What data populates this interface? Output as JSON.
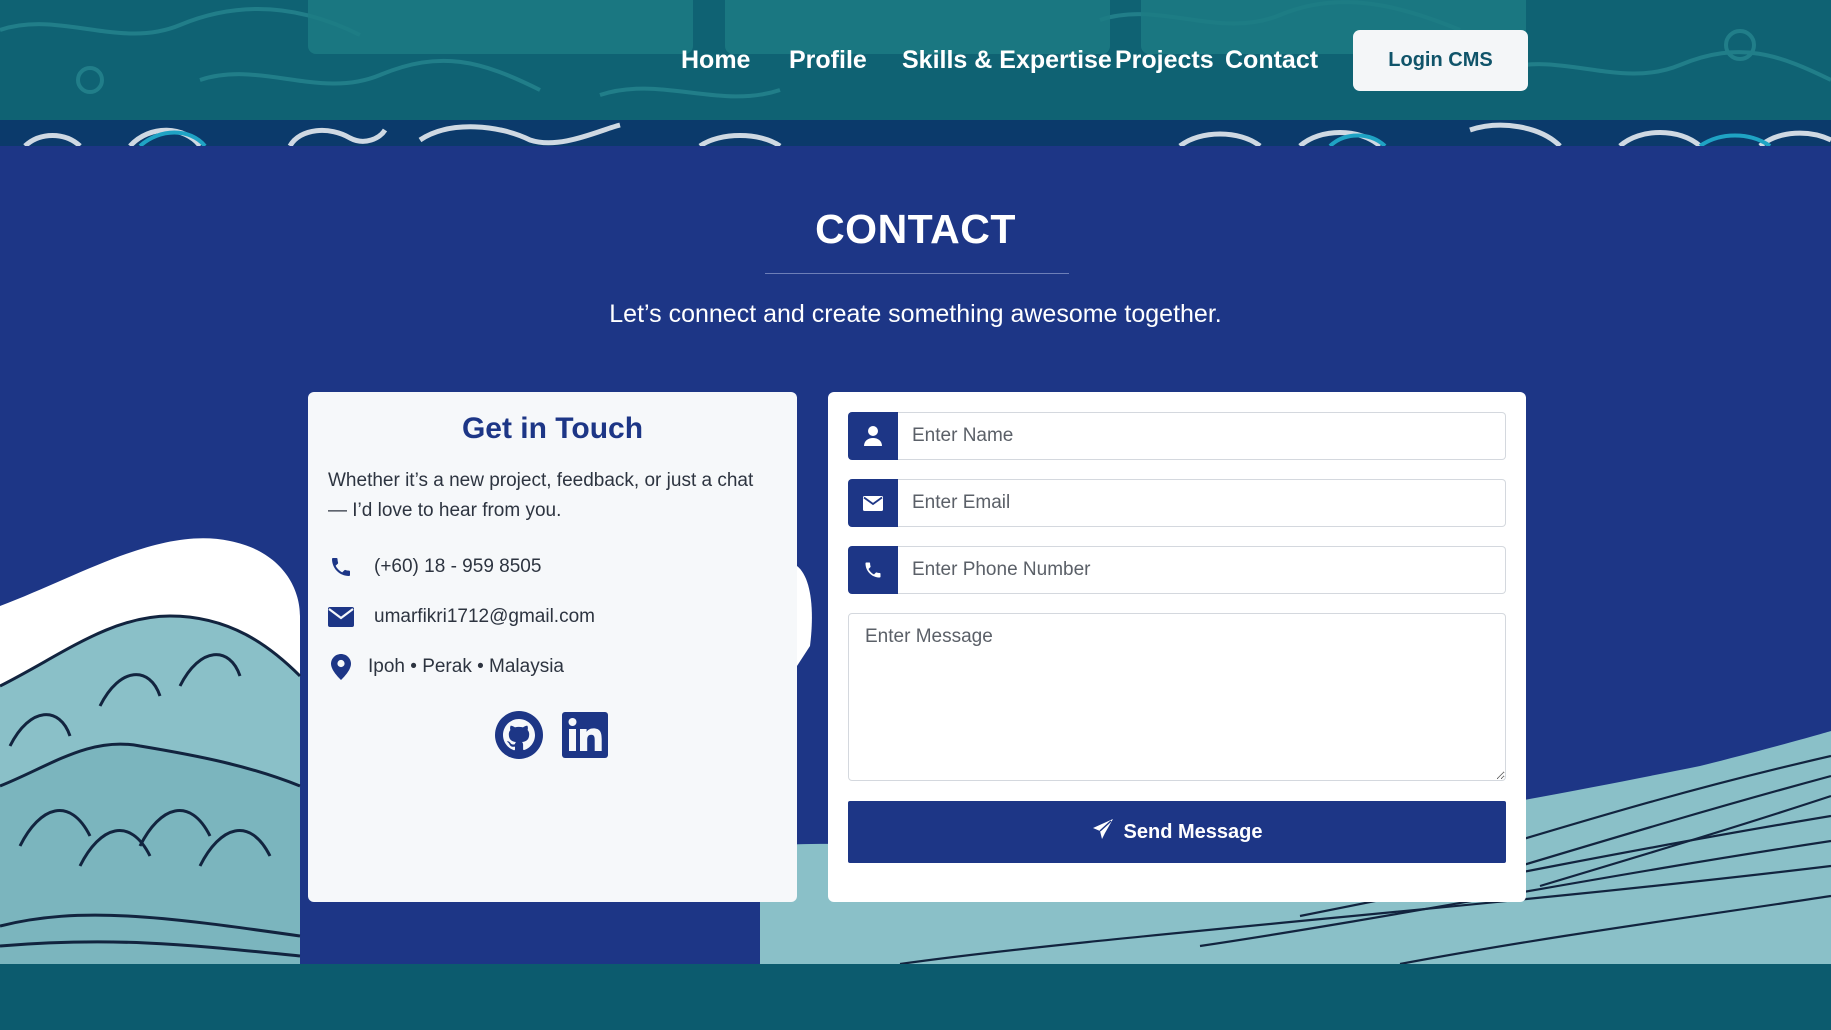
{
  "nav": {
    "items": [
      {
        "label": "Home"
      },
      {
        "label": "Profile"
      },
      {
        "label": "Skills & Expertise"
      },
      {
        "label": "Projects"
      },
      {
        "label": "Contact"
      }
    ],
    "login_label": "Login CMS"
  },
  "contact": {
    "title": "CONTACT",
    "subtitle": "Let’s connect and create something awesome together."
  },
  "info": {
    "title": "Get in Touch",
    "text": "Whether it’s a new project, feedback, or just a chat — I’d love to hear from you.",
    "phone": "(+60) 18 - 959 8505",
    "email": "umarfikri1712@gmail.com",
    "location": "Ipoh • Perak • Malaysia",
    "social_icons": [
      "github-icon",
      "linkedin-icon"
    ]
  },
  "form": {
    "name_placeholder": "Enter Name",
    "email_placeholder": "Enter Email",
    "phone_placeholder": "Enter Phone Number",
    "message_placeholder": "Enter Message",
    "send_label": "Send Message"
  },
  "colors": {
    "primary": "#1d3686",
    "header_teal": "#0f6273",
    "wave_light": "#8ac0c8",
    "card_bg": "#f6f8fa"
  }
}
